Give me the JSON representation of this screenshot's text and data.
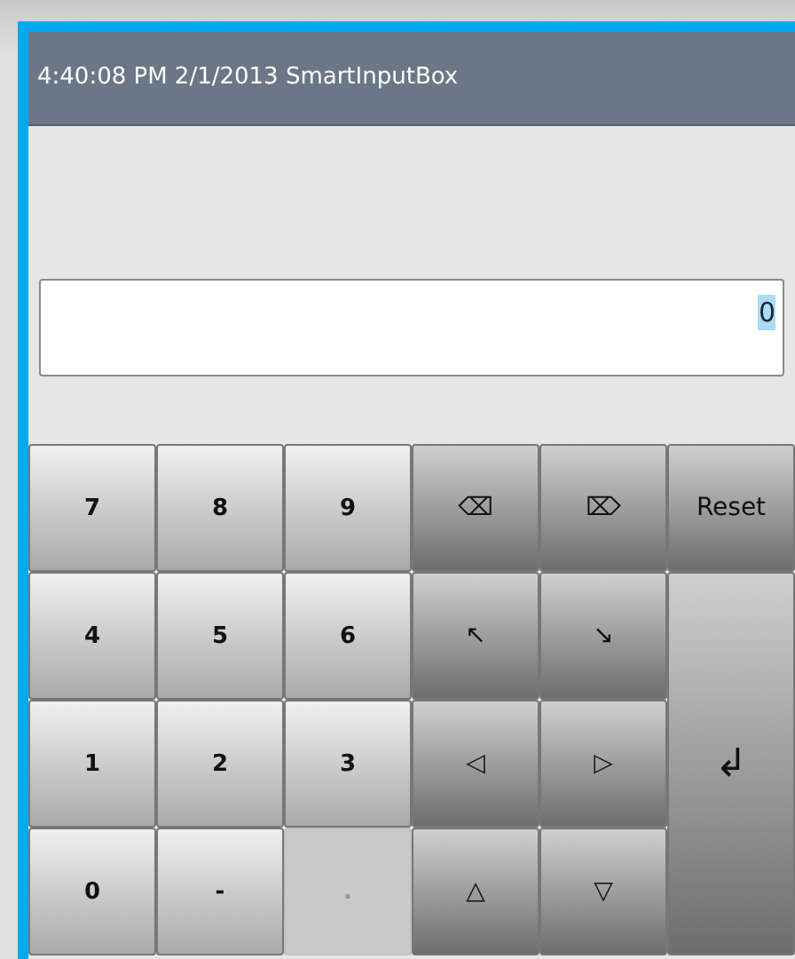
{
  "window": {
    "title": "4:40:08 PM 2/1/2013 SmartInputBox"
  },
  "input": {
    "value": "0",
    "selected": true
  },
  "keys": [
    {
      "label": "7",
      "kind": "digit",
      "disabled": false
    },
    {
      "label": "8",
      "kind": "digit",
      "disabled": false
    },
    {
      "label": "9",
      "kind": "digit",
      "disabled": false
    },
    {
      "label": "⌫",
      "kind": "action",
      "disabled": false
    },
    {
      "label": "⌦",
      "kind": "action",
      "disabled": false
    },
    {
      "label": "4",
      "kind": "digit",
      "disabled": false
    },
    {
      "label": "5",
      "kind": "digit",
      "disabled": false
    },
    {
      "label": "6",
      "kind": "digit",
      "disabled": false
    },
    {
      "label": "↖",
      "kind": "action",
      "disabled": false
    },
    {
      "label": "↘",
      "kind": "action",
      "disabled": false
    },
    {
      "label": "1",
      "kind": "digit",
      "disabled": false
    },
    {
      "label": "2",
      "kind": "digit",
      "disabled": false
    },
    {
      "label": "3",
      "kind": "digit",
      "disabled": false
    },
    {
      "label": "◁",
      "kind": "action",
      "disabled": false
    },
    {
      "label": "▷",
      "kind": "action",
      "disabled": false
    },
    {
      "label": "0",
      "kind": "digit",
      "disabled": false
    },
    {
      "label": "-",
      "kind": "digit",
      "disabled": false
    },
    {
      "label": ".",
      "kind": "digit",
      "disabled": true
    },
    {
      "label": "△",
      "kind": "action",
      "disabled": false
    },
    {
      "label": "▽",
      "kind": "action",
      "disabled": false
    }
  ],
  "side_keys": [
    {
      "label": "Reset",
      "kind": "action"
    },
    {
      "label": "↲",
      "kind": "enter"
    }
  ]
}
